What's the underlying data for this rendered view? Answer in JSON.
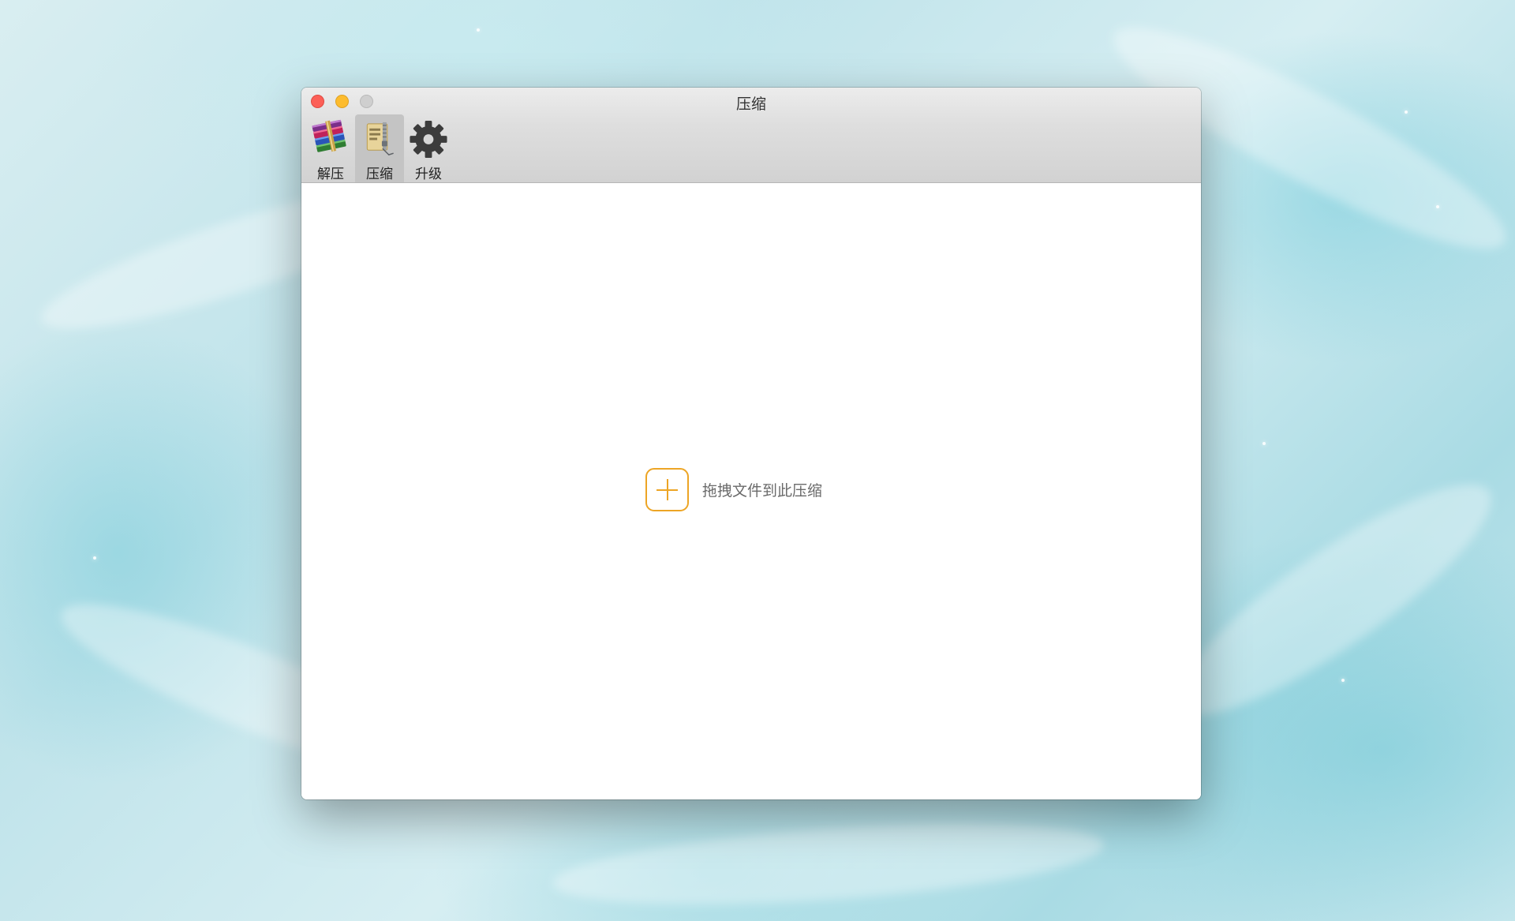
{
  "window": {
    "title": "压缩"
  },
  "toolbar": {
    "items": [
      {
        "label": "解压",
        "icon": "books-archive-icon",
        "selected": false
      },
      {
        "label": "压缩",
        "icon": "zipper-file-icon",
        "selected": true
      },
      {
        "label": "升级",
        "icon": "gear-icon",
        "selected": false
      }
    ]
  },
  "dropzone": {
    "text": "拖拽文件到此压缩",
    "icon": "plus-icon",
    "accent_color": "#EDA525"
  }
}
